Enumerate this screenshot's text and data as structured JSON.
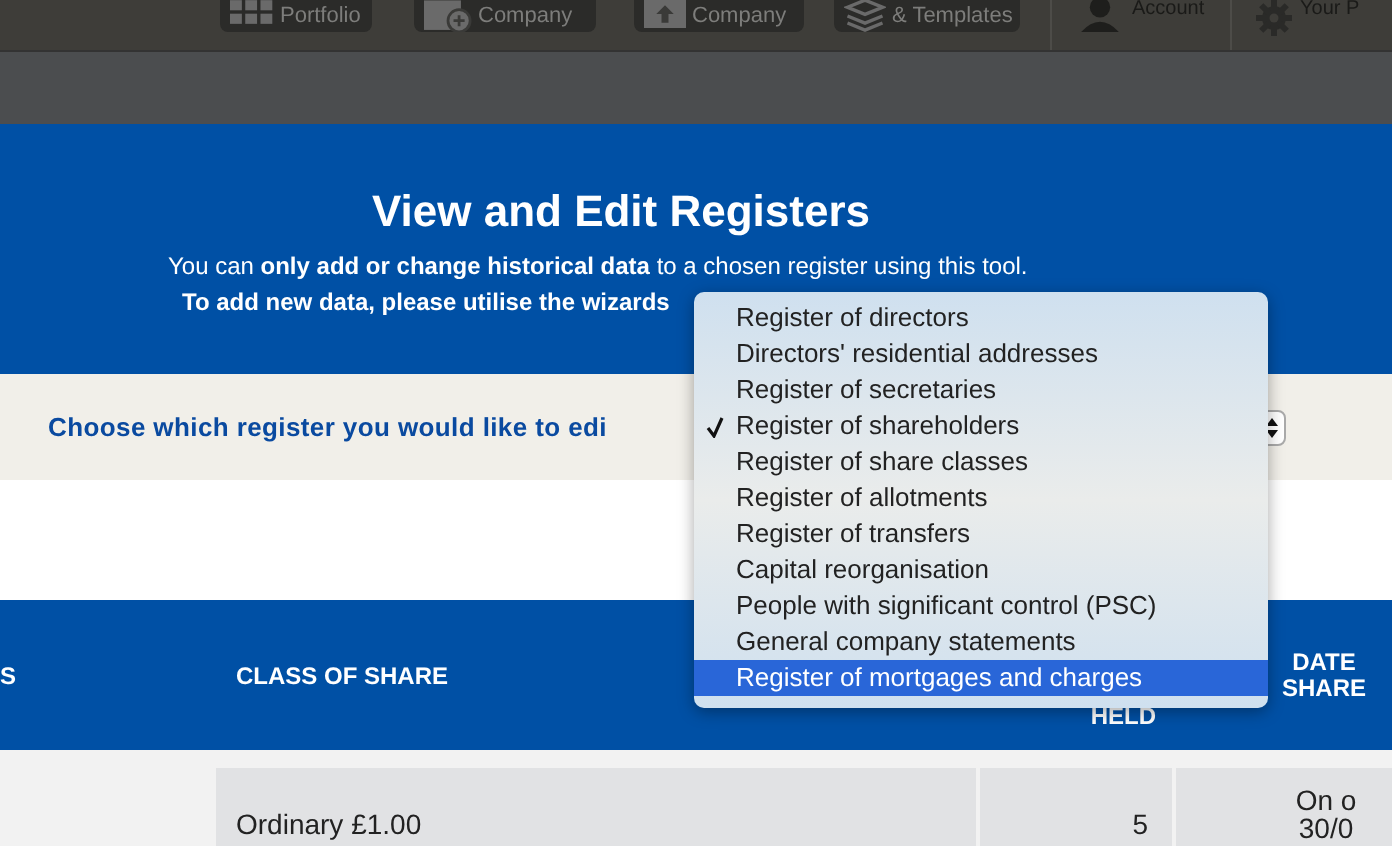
{
  "nav": [
    {
      "label": "Portfolio"
    },
    {
      "label": "Company"
    },
    {
      "label": "Company"
    },
    {
      "label": "& Templates"
    }
  ],
  "user_menu": [
    {
      "label": "Account"
    },
    {
      "label": "Your P"
    }
  ],
  "panel": {
    "title": "View and Edit Registers",
    "line_1": "You can **only add or change historical data** to a chosen register using this tool.",
    "line_2": "To add new data, please utilise the wizards"
  },
  "chooser": {
    "label": "Choose which register you would like to edi"
  },
  "register_menu": [
    {
      "label": "Register of directors",
      "checked": false,
      "selected": false
    },
    {
      "label": "Directors' residential addresses",
      "checked": false,
      "selected": false
    },
    {
      "label": "Register of secretaries",
      "checked": false,
      "selected": false
    },
    {
      "label": "Register of shareholders",
      "checked": true,
      "selected": false
    },
    {
      "label": "Register of share classes",
      "checked": false,
      "selected": false
    },
    {
      "label": "Register of allotments",
      "checked": false,
      "selected": false
    },
    {
      "label": "Register of transfers",
      "checked": false,
      "selected": false
    },
    {
      "label": "Capital reorganisation",
      "checked": false,
      "selected": false
    },
    {
      "label": "People with significant control (PSC)",
      "checked": false,
      "selected": false
    },
    {
      "label": "General company statements",
      "checked": false,
      "selected": false
    },
    {
      "label": "Register of mortgages and charges",
      "checked": false,
      "selected": true
    }
  ],
  "table": {
    "columns": [
      "S",
      "CLASS OF SHARE",
      "HELD",
      [
        "DATE",
        "SHARE"
      ]
    ],
    "rows": [
      [
        "",
        "Ordinary £1.00",
        "5",
        [
          "On o",
          "30/0"
        ]
      ]
    ]
  }
}
